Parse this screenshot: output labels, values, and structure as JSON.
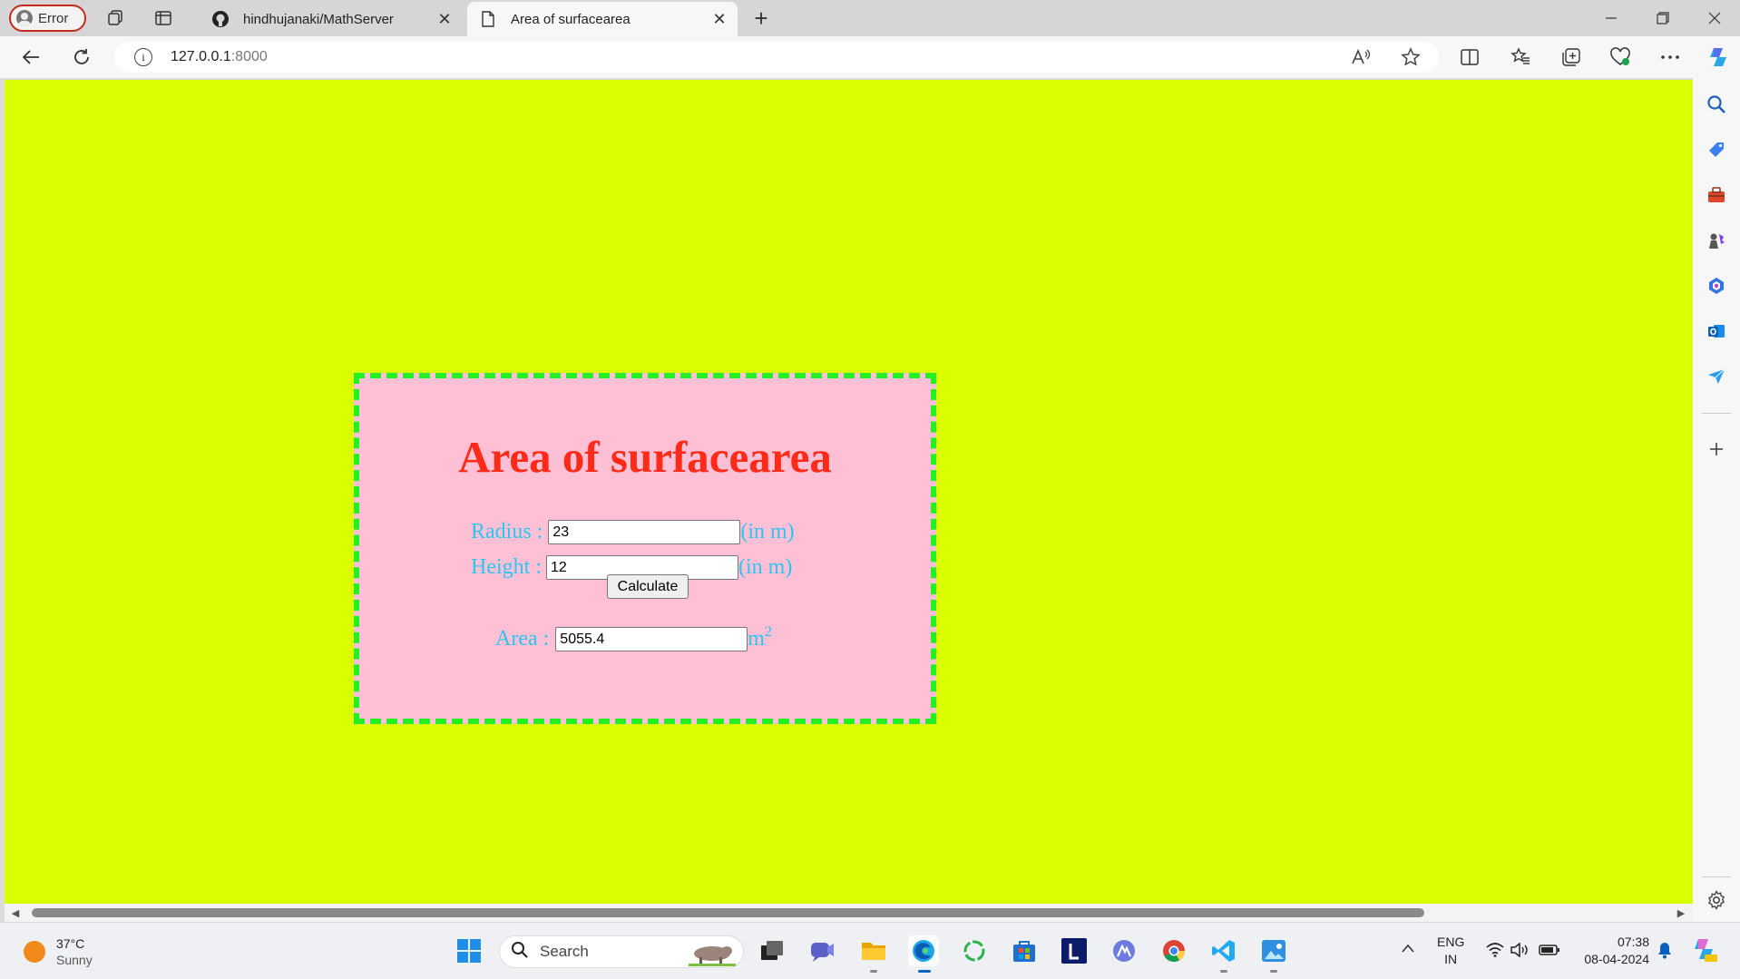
{
  "browser": {
    "profile_label": "Error",
    "tabs": [
      {
        "title": "hindhujanaki/MathServer",
        "icon": "github-icon",
        "active": false
      },
      {
        "title": "Area of surfacearea",
        "icon": "page-icon",
        "active": true
      }
    ],
    "url_host": "127.0.0.1",
    "url_port": ":8000"
  },
  "page": {
    "background": "#d9ff00",
    "card_background": "#ffbfd5",
    "card_border": "#23ef23",
    "title_color": "#ff2a17",
    "label_color": "#29c7f2",
    "heading": "Area of surfacearea",
    "radius_label": "Radius :",
    "radius_value": "23",
    "radius_unit": "(in m)",
    "height_label": "Height :",
    "height_value": "12",
    "height_unit": "(in m)",
    "calculate_label": "Calculate",
    "area_label": "Area :",
    "area_value": "5055.4",
    "area_unit": "m",
    "area_unit_sup": "2"
  },
  "taskbar": {
    "weather_temp": "37°C",
    "weather_cond": "Sunny",
    "search_placeholder": "Search",
    "lang_top": "ENG",
    "lang_bottom": "IN",
    "time": "07:38",
    "date": "08-04-2024",
    "apps": [
      "windows-start-icon",
      "task-view-icon",
      "teams-chat-icon",
      "file-explorer-icon",
      "edge-icon",
      "refresh-app-icon",
      "store-icon",
      "l-app-icon",
      "arc-app-icon",
      "chrome-icon",
      "vscode-icon",
      "photos-icon"
    ]
  }
}
